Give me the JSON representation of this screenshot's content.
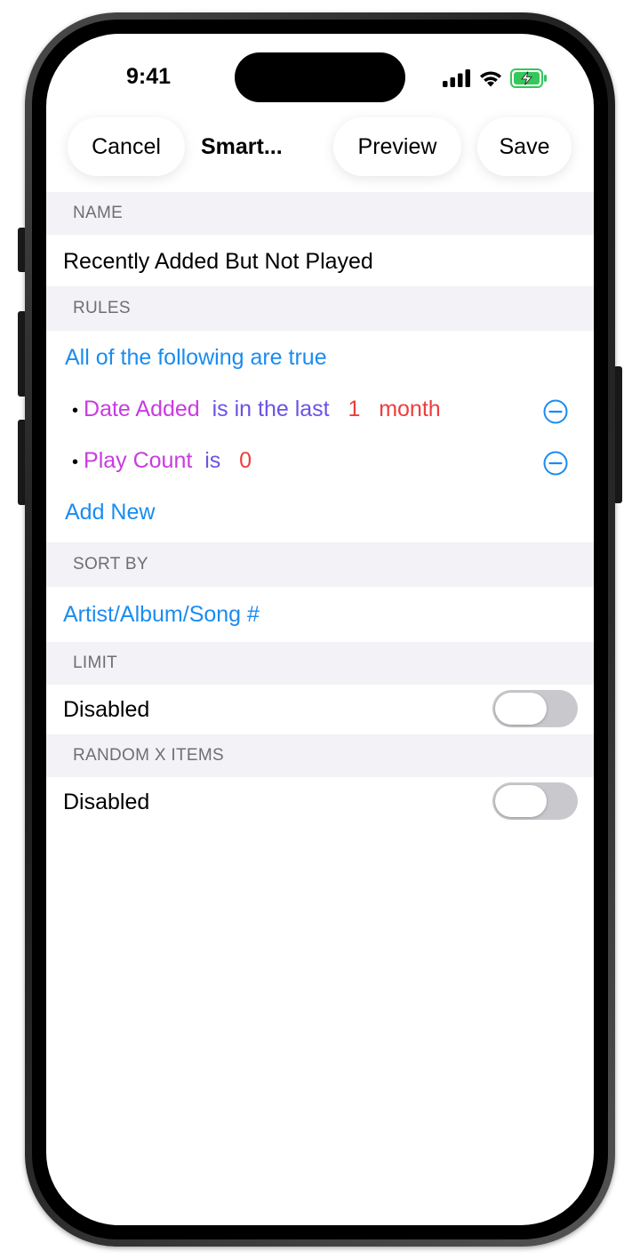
{
  "status_bar": {
    "time": "9:41",
    "icons": [
      "cellular-signal-icon",
      "wifi-icon",
      "battery-charging-icon"
    ]
  },
  "nav": {
    "cancel_label": "Cancel",
    "title": "Smart...",
    "preview_label": "Preview",
    "save_label": "Save"
  },
  "sections": {
    "name": {
      "header": "NAME",
      "value": "Recently Added But Not Played"
    },
    "rules": {
      "header": "RULES",
      "match_mode": "All of the following are true",
      "items": [
        {
          "field": "Date Added",
          "operator": "is in the last",
          "value": "1",
          "unit": "month"
        },
        {
          "field": "Play Count",
          "operator": "is",
          "value": "0"
        }
      ],
      "add_label": "Add New"
    },
    "sort_by": {
      "header": "SORT BY",
      "value": "Artist/Album/Song #"
    },
    "limit": {
      "header": "LIMIT",
      "label": "Disabled",
      "enabled": false
    },
    "random": {
      "header": "RANDOM X ITEMS",
      "label": "Disabled",
      "enabled": false
    }
  },
  "colors": {
    "accent": "#1a8cf0",
    "field": "#c93be0",
    "operator": "#6a54e6",
    "value": "#ee3d3d",
    "section_bg": "#f2f2f7",
    "battery": "#34c759"
  }
}
